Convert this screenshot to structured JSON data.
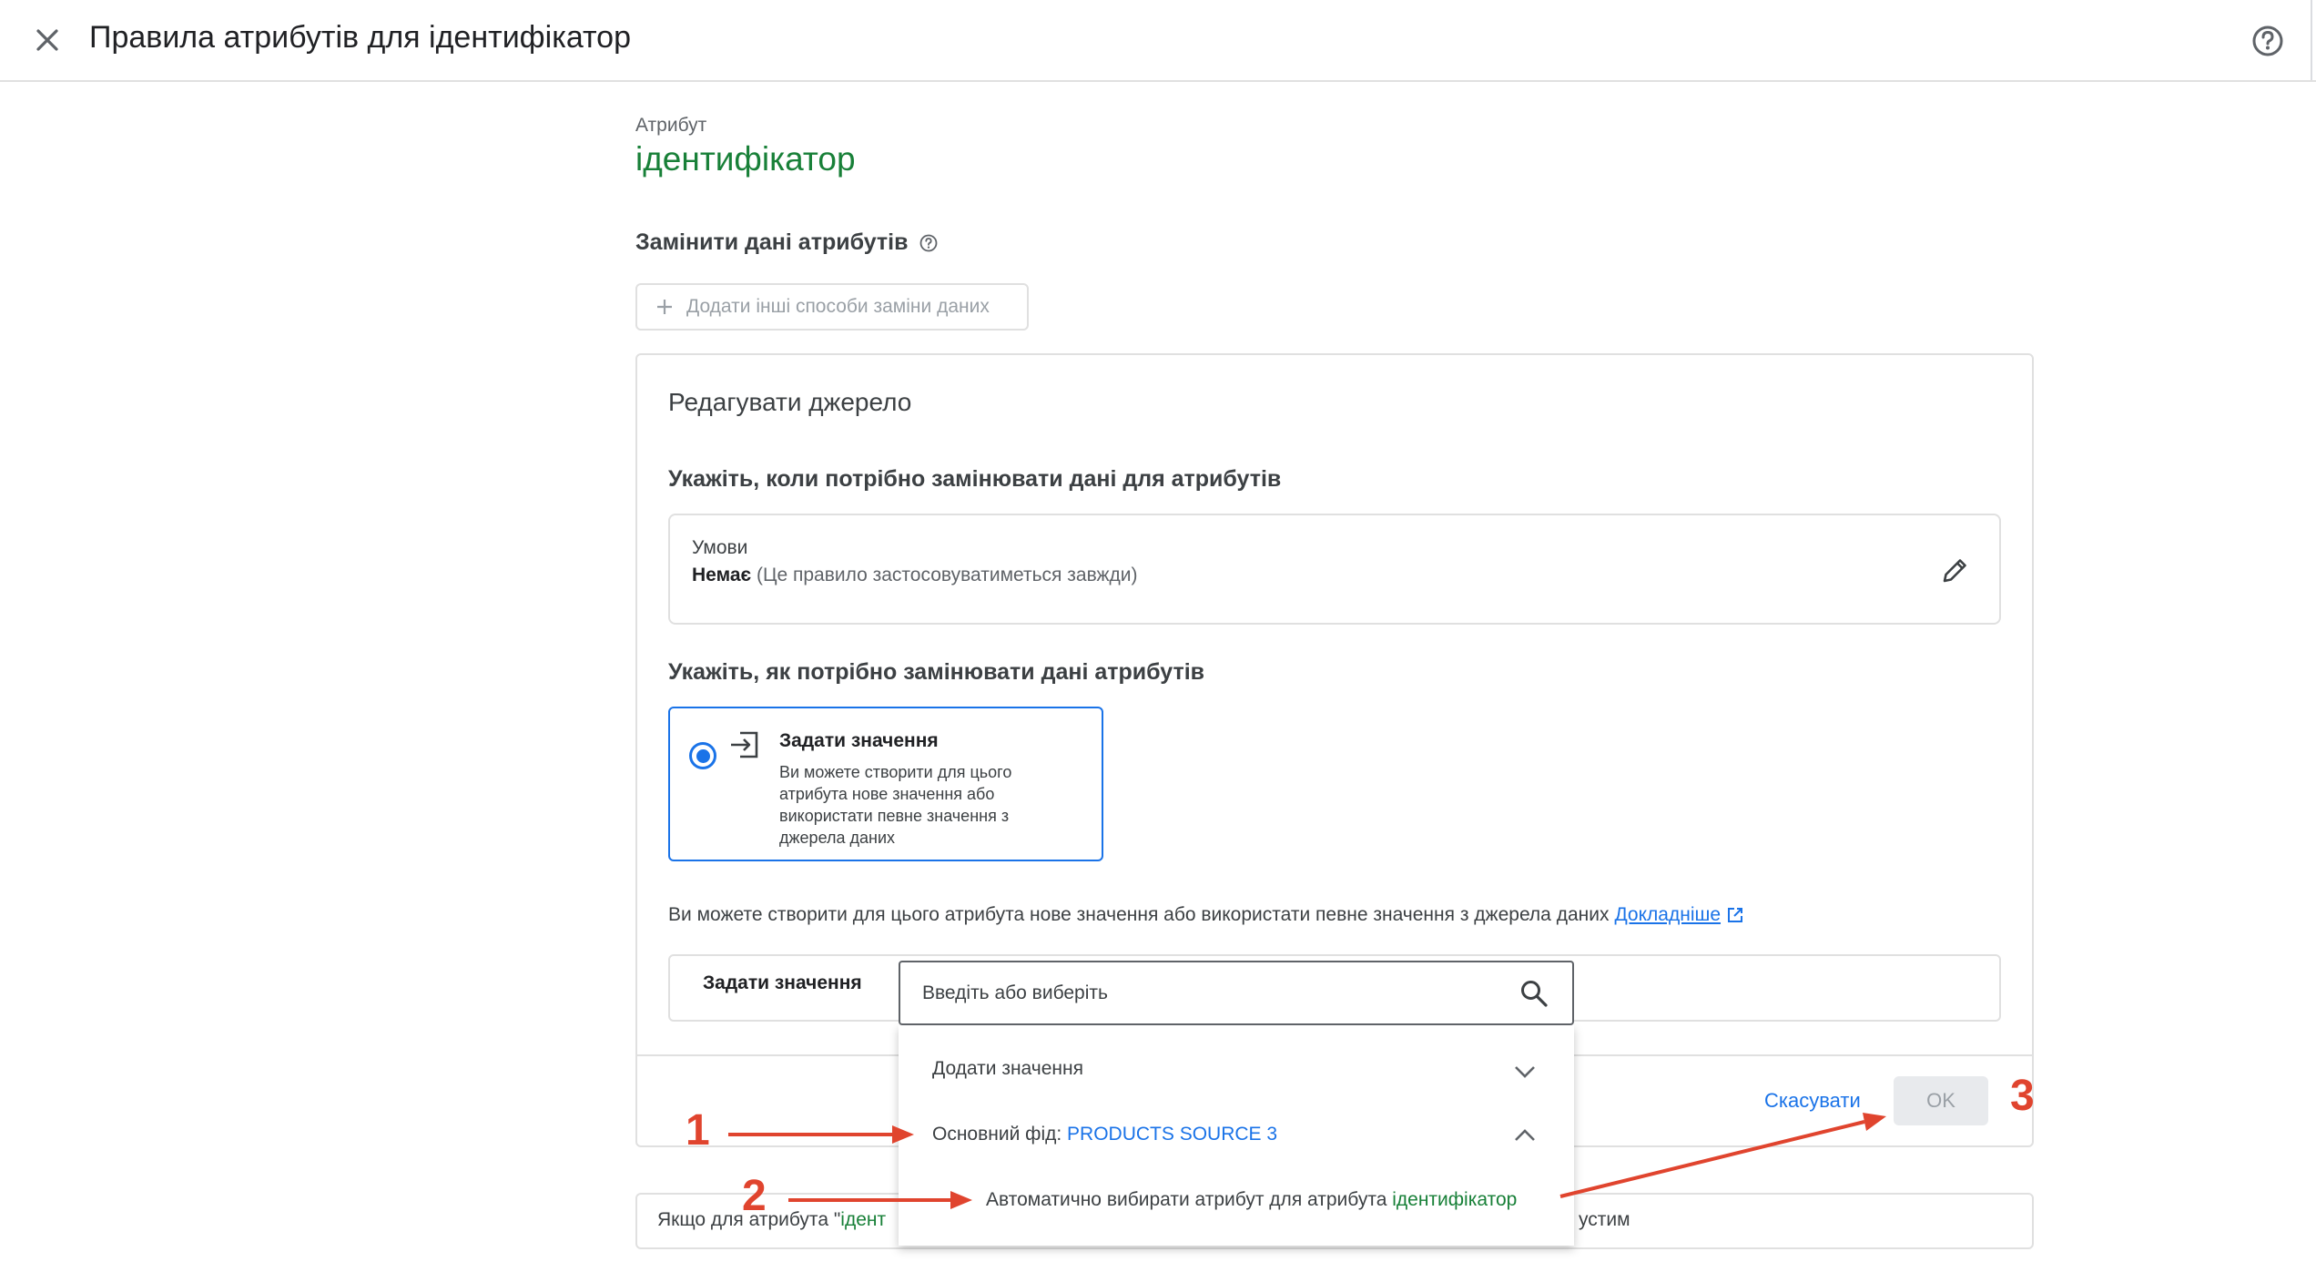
{
  "header": {
    "title": "Правила атрибутів для ідентифікатор"
  },
  "attribute": {
    "label": "Атрибут",
    "name": "ідентифікатор"
  },
  "replace": {
    "title": "Замінити дані атрибутів",
    "add_methods_label": "Додати інші способи заміни даних"
  },
  "edit_source": {
    "title": "Редагувати джерело",
    "when_question": "Укажіть, коли потрібно замінювати дані для атрибутів",
    "conditions": {
      "label": "Умови",
      "value_bold": "Немає",
      "value_note": "(Це правило застосовуватиметься завжди)"
    },
    "how_question": "Укажіть, як потрібно замінювати дані атрибутів",
    "option": {
      "title": "Задати значення",
      "description": "Ви можете створити для цього атрибута нове значення або використати певне значення з джерела даних",
      "selected": true
    },
    "info_text": "Ви можете створити для цього атрибута нове значення або використати певне значення з джерела даних",
    "learn_more": "Докладніше",
    "set_value_label": "Задати значення",
    "cancel_label": "Скасувати",
    "ok_label": "OK"
  },
  "dropdown": {
    "placeholder": "Введіть або виберіть",
    "add_value": "Додати значення",
    "primary_feed_prefix": "Основний фід: ",
    "primary_feed_source": "PRODUCTS SOURCE 3",
    "auto_select_prefix": "Автоматично вибирати атрибут для атрибута ",
    "auto_select_attr": "ідентифікатор"
  },
  "bottom_note": {
    "left_prefix": "Якщо для атрибута \"",
    "left_green": "ідент",
    "right_fragment": "устим"
  },
  "annotations": {
    "step1": "1",
    "step2": "2",
    "step3": "3"
  },
  "colors": {
    "accent_blue": "#1a73e8",
    "attribute_green": "#188038",
    "annotation_red": "#e0442e"
  }
}
